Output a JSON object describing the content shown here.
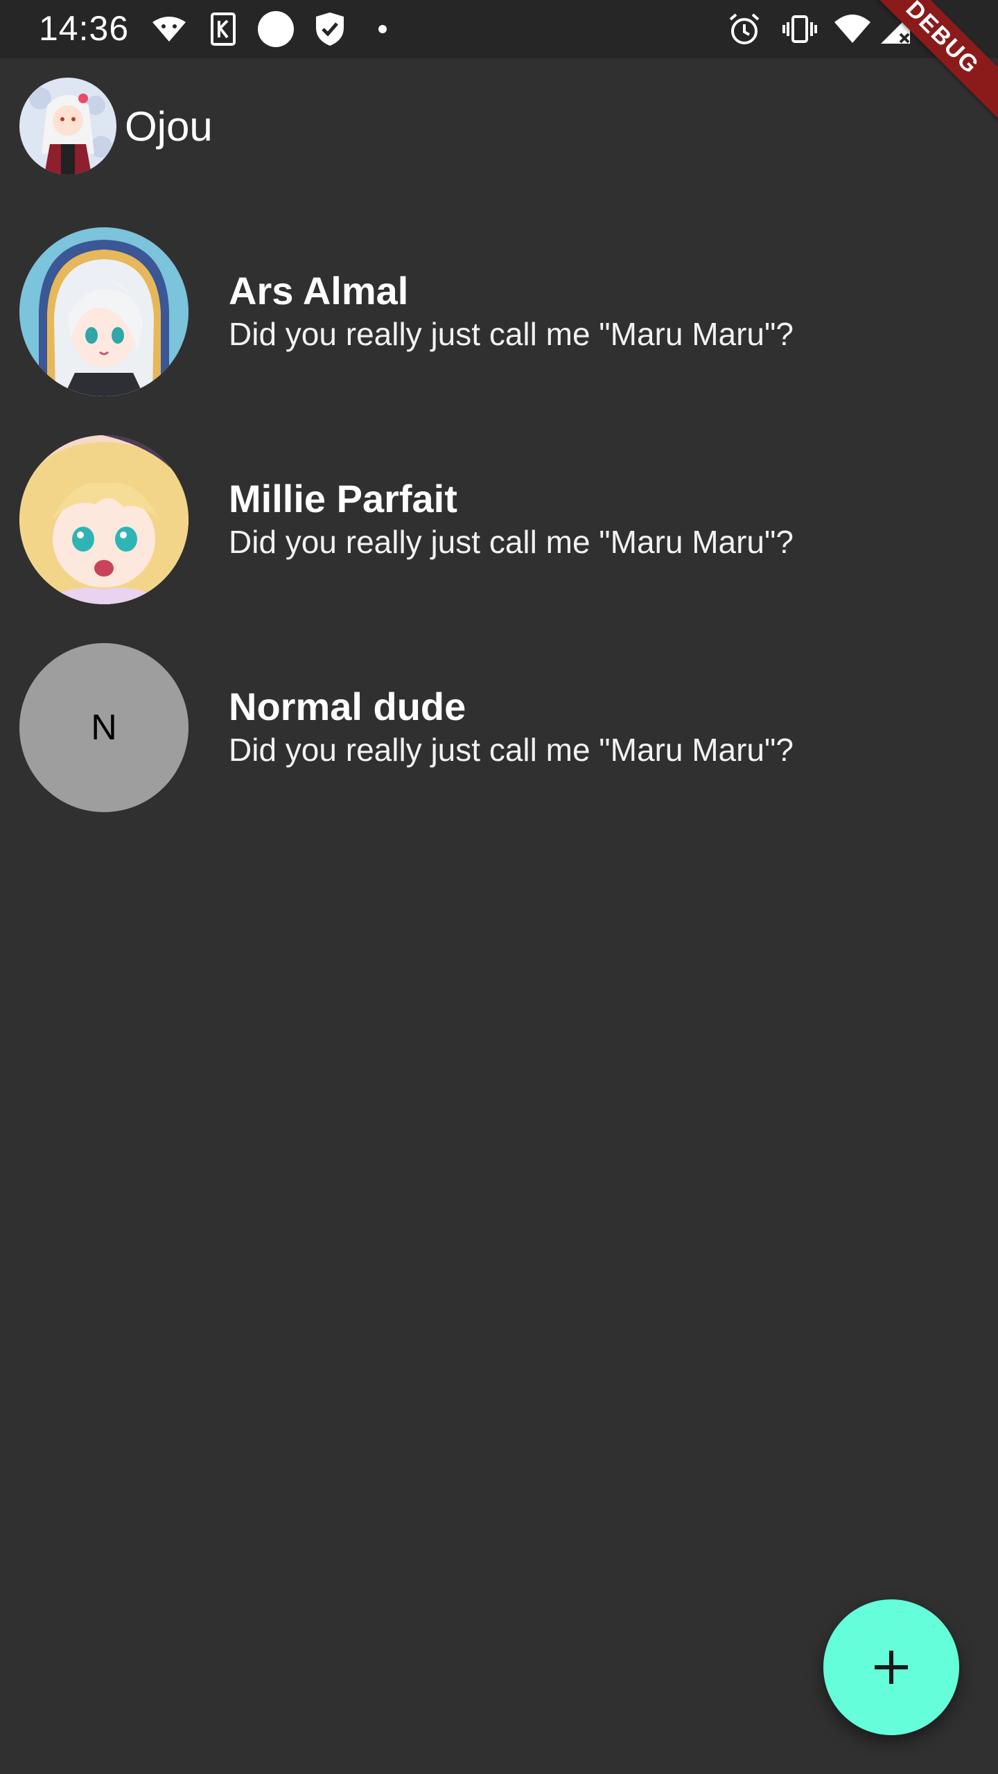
{
  "status_bar": {
    "time": "14:36",
    "icons": [
      "android-debug-icon",
      "k-app-icon",
      "circle-icon",
      "shield-check-icon",
      "dot-icon",
      "alarm-icon",
      "vibrate-icon",
      "wifi-icon",
      "signal-icon",
      "battery-icon"
    ]
  },
  "debug_banner": "DEBUG",
  "header": {
    "title": "Ojou"
  },
  "chats": [
    {
      "name": "Ars Almal",
      "message": "Did you really just call me \"Maru Maru\"?"
    },
    {
      "name": "Millie Parfait",
      "message": "Did you really just call me \"Maru Maru\"?"
    },
    {
      "name": "Normal dude",
      "message": "Did you really just call me \"Maru Maru\"?",
      "initial": "N"
    }
  ],
  "fab": {
    "icon": "plus-icon",
    "color": "#64ffda"
  },
  "colors": {
    "background": "#303030",
    "status_bar": "#262626",
    "accent": "#64ffda",
    "debug": "#8b1b1b",
    "letter_avatar": "#9e9e9e"
  }
}
